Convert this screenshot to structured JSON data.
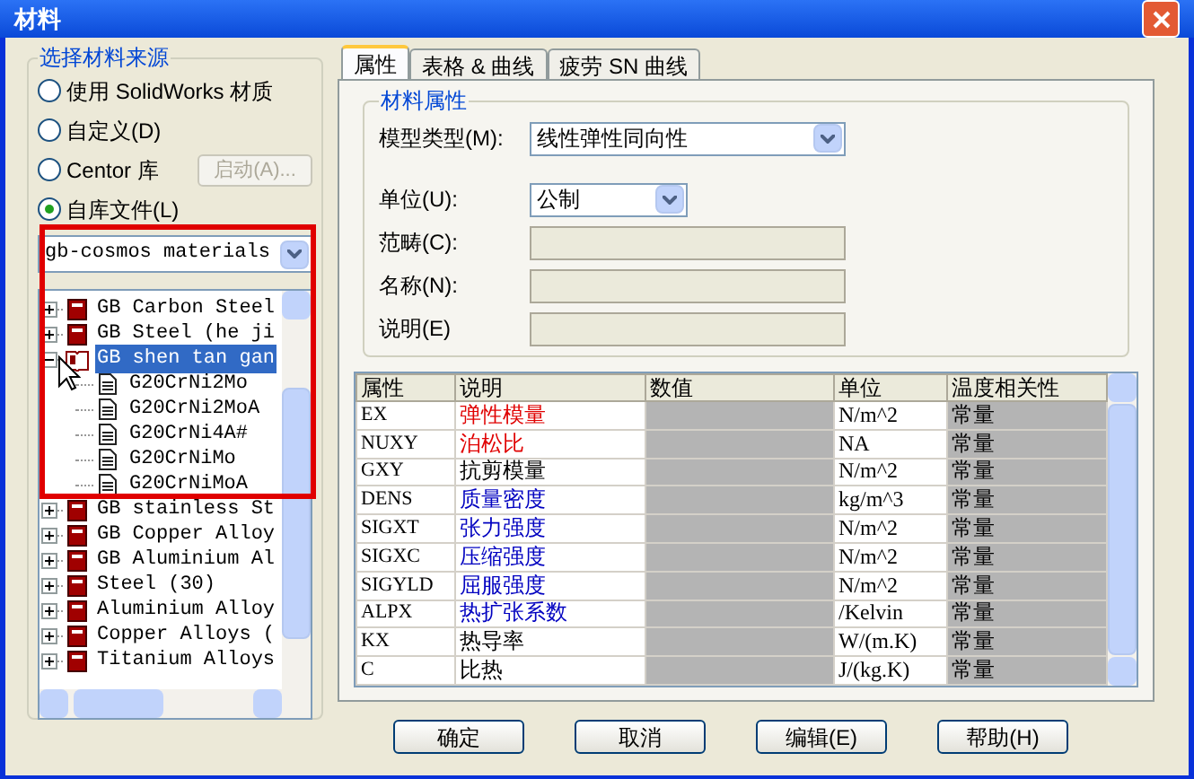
{
  "window": {
    "title": "材料"
  },
  "source": {
    "legend": "选择材料来源",
    "options": [
      {
        "label": "使用 SolidWorks 材质",
        "selected": false
      },
      {
        "label": "自定义(D)",
        "selected": false
      },
      {
        "label": "Centor 库",
        "selected": false,
        "button": {
          "label": "启动(A)...",
          "disabled": true
        }
      },
      {
        "label": "自库文件(L)",
        "selected": true
      }
    ],
    "library": {
      "value": "gb-cosmos materials"
    },
    "tree": [
      {
        "label": "GB Carbon Steel",
        "expanded": false,
        "selected": false
      },
      {
        "label": "GB Steel (he ji",
        "expanded": false,
        "selected": false
      },
      {
        "label": "GB shen tan gan",
        "expanded": true,
        "selected": true,
        "children": [
          {
            "label": "G20CrNi2Mo"
          },
          {
            "label": "G20CrNi2MoA"
          },
          {
            "label": "G20CrNi4A#"
          },
          {
            "label": "G20CrNiMo"
          },
          {
            "label": "G20CrNiMoA"
          }
        ]
      },
      {
        "label": "GB stainless St",
        "expanded": false,
        "selected": false
      },
      {
        "label": "GB Copper Alloy",
        "expanded": false,
        "selected": false
      },
      {
        "label": "GB Aluminium Al",
        "expanded": false,
        "selected": false
      },
      {
        "label": "Steel (30)",
        "expanded": false,
        "selected": false
      },
      {
        "label": "Aluminium Alloy",
        "expanded": false,
        "selected": false
      },
      {
        "label": "Copper Alloys (",
        "expanded": false,
        "selected": false
      },
      {
        "label": "Titanium Alloys",
        "expanded": false,
        "selected": false
      }
    ]
  },
  "tabs": [
    {
      "label": "属性",
      "selected": true
    },
    {
      "label": "表格 & 曲线",
      "selected": false
    },
    {
      "label": "疲劳 SN 曲线",
      "selected": false
    }
  ],
  "properties": {
    "legend": "材料属性",
    "fields": [
      {
        "kind": "select",
        "label": "模型类型(M):",
        "value": "线性弹性同向性"
      },
      {
        "kind": "select",
        "label": "单位(U):",
        "value": "公制"
      },
      {
        "kind": "text",
        "label": "范畴(C):",
        "disabled": true
      },
      {
        "kind": "text",
        "label": "名称(N):",
        "disabled": true
      },
      {
        "kind": "text",
        "label": "说明(E)",
        "disabled": true
      }
    ]
  },
  "table": {
    "columns": [
      "属性",
      "说明",
      "数值",
      "单位",
      "温度相关性"
    ],
    "rows": [
      {
        "cells": [
          "EX",
          "弹性模量",
          "",
          "N/m^2",
          "常量"
        ],
        "color": "#e00000"
      },
      {
        "cells": [
          "NUXY",
          "泊松比",
          "",
          "NA",
          "常量"
        ],
        "color": "#e00000"
      },
      {
        "cells": [
          "GXY",
          "抗剪模量",
          "",
          "N/m^2",
          "常量"
        ],
        "color": "#000000"
      },
      {
        "cells": [
          "DENS",
          "质量密度",
          "",
          "kg/m^3",
          "常量"
        ],
        "color": "#0000c0"
      },
      {
        "cells": [
          "SIGXT",
          "张力强度",
          "",
          "N/m^2",
          "常量"
        ],
        "color": "#0000c0"
      },
      {
        "cells": [
          "SIGXC",
          "压缩强度",
          "",
          "N/m^2",
          "常量"
        ],
        "color": "#0000c0"
      },
      {
        "cells": [
          "SIGYLD",
          "屈服强度",
          "",
          "N/m^2",
          "常量"
        ],
        "color": "#0000c0"
      },
      {
        "cells": [
          "ALPX",
          "热扩张系数",
          "",
          "/Kelvin",
          "常量"
        ],
        "color": "#0000c0"
      },
      {
        "cells": [
          "KX",
          "热导率",
          "",
          "W/(m.K)",
          "常量"
        ],
        "color": "#000000"
      },
      {
        "cells": [
          "C",
          "比热",
          "",
          "J/(kg.K)",
          "常量"
        ],
        "color": "#000000"
      }
    ]
  },
  "buttons": [
    "确定",
    "取消",
    "编辑(E)",
    "帮助(H)"
  ]
}
